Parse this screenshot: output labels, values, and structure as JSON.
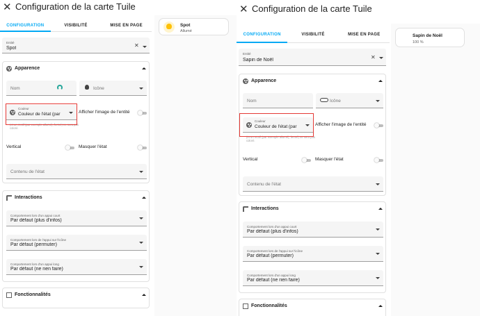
{
  "left": {
    "title": "Configuration de la carte Tuile",
    "tabs": [
      "CONFIGURATION",
      "VISIBILITÉ",
      "MISE EN PAGE"
    ],
    "preview": {
      "name": "Spot",
      "state": "Allumé"
    },
    "entity": {
      "label": "Entité",
      "value": "Spot"
    },
    "appearance": {
      "title": "Apparence",
      "name_placeholder": "Nom",
      "icon_placeholder": "Icône",
      "color_label": "Couleur",
      "color_value": "Couleur de l'état (par",
      "color_helper": "(et un motif (par exemple allumé), fermé) ne sera pas coloré.",
      "show_image": "Afficher l'image de l'entité",
      "vertical": "Vertical",
      "hide_state": "Masquer l'état",
      "state_content": "Contenu de l'état"
    },
    "interactions": {
      "title": "Interactions",
      "tap_label": "Comportement lors d'un appui court",
      "tap_value": "Par défaut (plus d'infos)",
      "icon_tap_label": "Comportement lors de l'appui sur l'icône",
      "icon_tap_value": "Par défaut (permuter)",
      "hold_label": "Comportement lors d'un appui long",
      "hold_value": "Par défaut (ne rien faire)"
    },
    "features": {
      "title": "Fonctionnalités"
    }
  },
  "right": {
    "title": "Configuration de la carte Tuile",
    "tabs": [
      "CONFIGURATION",
      "VISIBILITÉ",
      "MISE EN PAGE"
    ],
    "preview": {
      "name": "Sapin de Noël",
      "state": "100 %"
    },
    "entity": {
      "label": "Entité",
      "value": "Sapin de Noël"
    },
    "appearance": {
      "title": "Apparence",
      "name_placeholder": "Nom",
      "icon_placeholder": "Icône",
      "color_label": "Couleur",
      "color_value": "Couleur de l'état (par",
      "color_helper": "(et un motif (par exemple allumé), fermé) ne sera pas coloré.",
      "show_image": "Afficher l'image de l'entité",
      "vertical": "Vertical",
      "hide_state": "Masquer l'état",
      "state_content": "Contenu de l'état"
    },
    "interactions": {
      "title": "Interactions",
      "tap_label": "Comportement lors d'un appui court",
      "tap_value": "Par défaut (plus d'infos)",
      "icon_tap_label": "Comportement lors de l'appui sur l'icône",
      "icon_tap_value": "Par défaut (permuter)",
      "hold_label": "Comportement lors d'un appui long",
      "hold_value": "Par défaut (ne rien faire)"
    },
    "features": {
      "title": "Fonctionnalités"
    }
  },
  "colors": {
    "accent": "#03a9f4",
    "highlight": "#e53935",
    "bulb": "#ffc107"
  },
  "icons": {
    "close": "close-icon",
    "palette": "palette-icon",
    "interactions": "touch-icon",
    "features": "list-icon",
    "dropdown": "chevron-down-icon"
  }
}
